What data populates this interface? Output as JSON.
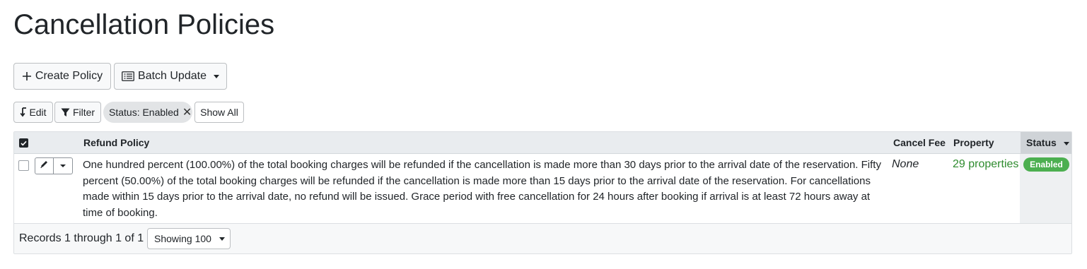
{
  "page": {
    "title": "Cancellation Policies"
  },
  "toolbar": {
    "create_label": "Create Policy",
    "batch_label": "Batch Update"
  },
  "filterbar": {
    "edit_label": "Edit",
    "filter_label": "Filter",
    "status_chip": "Status: Enabled",
    "show_all_label": "Show All"
  },
  "table": {
    "headers": {
      "refund_policy": "Refund Policy",
      "cancel_fee": "Cancel Fee",
      "property": "Property",
      "status": "Status"
    },
    "rows": [
      {
        "refund_policy": "One hundred percent (100.00%) of the total booking charges will be refunded if the cancellation is made more than 30 days prior to the arrival date of the reservation. Fifty percent (50.00%) of the total booking charges will be refunded if the cancellation is made more than 15 days prior to the arrival date of the reservation. For cancellations made within 15 days prior to the arrival date, no refund will be issued. Grace period with free cancellation for 24 hours after booking if arrival is at least 72 hours away at time of booking.",
        "cancel_fee": "None",
        "property": "29 properties",
        "status": "Enabled"
      }
    ],
    "footer": {
      "records": "Records 1 through 1 of 1",
      "showing": "Showing 100"
    }
  },
  "colors": {
    "status_badge": "#4caf50",
    "property_link": "#2e8b2e",
    "header_bg": "#e9ecef"
  }
}
